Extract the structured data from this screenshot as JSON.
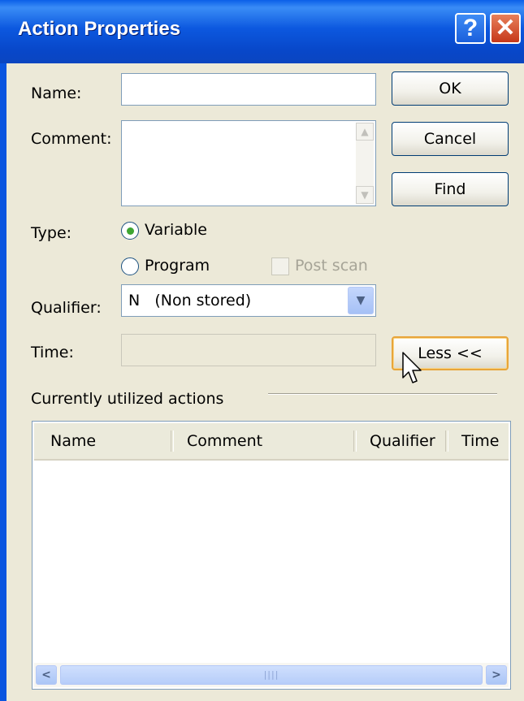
{
  "window": {
    "title": "Action Properties",
    "help_label": "?",
    "close_label": "✕"
  },
  "form": {
    "name_label": "Name:",
    "name_value": "",
    "comment_label": "Comment:",
    "comment_value": "",
    "type_label": "Type:",
    "type_options": [
      {
        "label": "Variable",
        "selected": true
      },
      {
        "label": "Program",
        "selected": false
      }
    ],
    "post_scan_label": "Post scan",
    "qualifier_label": "Qualifier:",
    "qualifier_value": "N   (Non stored)",
    "time_label": "Time:",
    "time_value": ""
  },
  "buttons": {
    "ok": "OK",
    "cancel": "Cancel",
    "find": "Find",
    "less": "Less <<"
  },
  "actions_group": {
    "label": "Currently utilized actions",
    "columns": [
      "Name",
      "Comment",
      "Qualifier",
      "Time"
    ],
    "rows": []
  },
  "icons": {
    "scroll_up": "scroll-up-icon",
    "scroll_down": "scroll-down-icon",
    "scroll_left": "scroll-left-icon",
    "scroll_right": "scroll-right-icon",
    "dropdown": "chevron-down-icon",
    "cursor": "mouse-pointer-icon"
  },
  "colors": {
    "titlebar": "#0a55e0",
    "dialog_bg": "#ece9d8",
    "radio_selected": "#3ea531",
    "focus_border": "#e8a53a"
  }
}
